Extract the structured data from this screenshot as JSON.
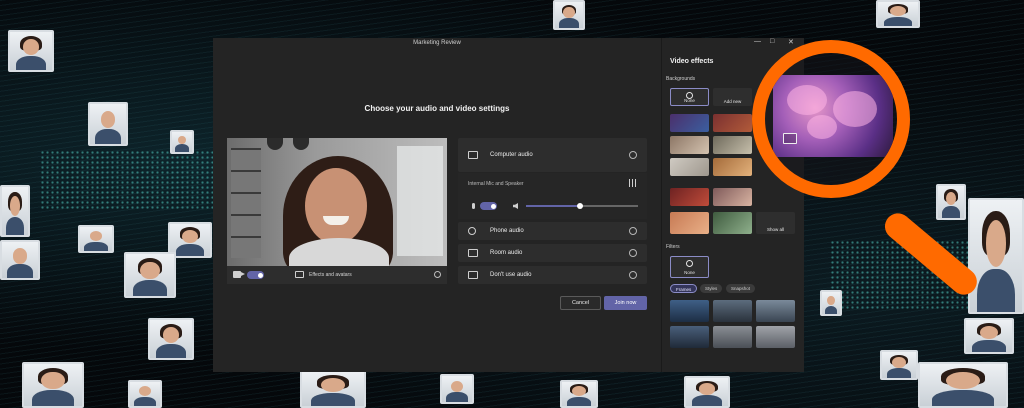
{
  "window": {
    "title": "Marketing Review"
  },
  "settings": {
    "heading": "Choose your audio and video settings"
  },
  "preview_bar": {
    "effects_label": "Effects and avatars"
  },
  "audio": {
    "computer": "Computer audio",
    "device_label": "Internal Mic and Speaker",
    "volume_fraction": 0.48,
    "phone": "Phone audio",
    "room": "Room audio",
    "none": "Don't use audio"
  },
  "actions": {
    "cancel": "Cancel",
    "join": "Join now"
  },
  "effects": {
    "title": "Video effects",
    "backgrounds_label": "Backgrounds",
    "none_label": "None",
    "add_label": "Add new",
    "show_all_label": "Show all",
    "filters_label": "Filters",
    "filter_none_label": "None",
    "tabs": [
      "Frames",
      "Styles",
      "Snapshot"
    ]
  },
  "colors": {
    "accent": "#6264a7",
    "magnifier": "#ff6a00",
    "panel": "#242424"
  }
}
